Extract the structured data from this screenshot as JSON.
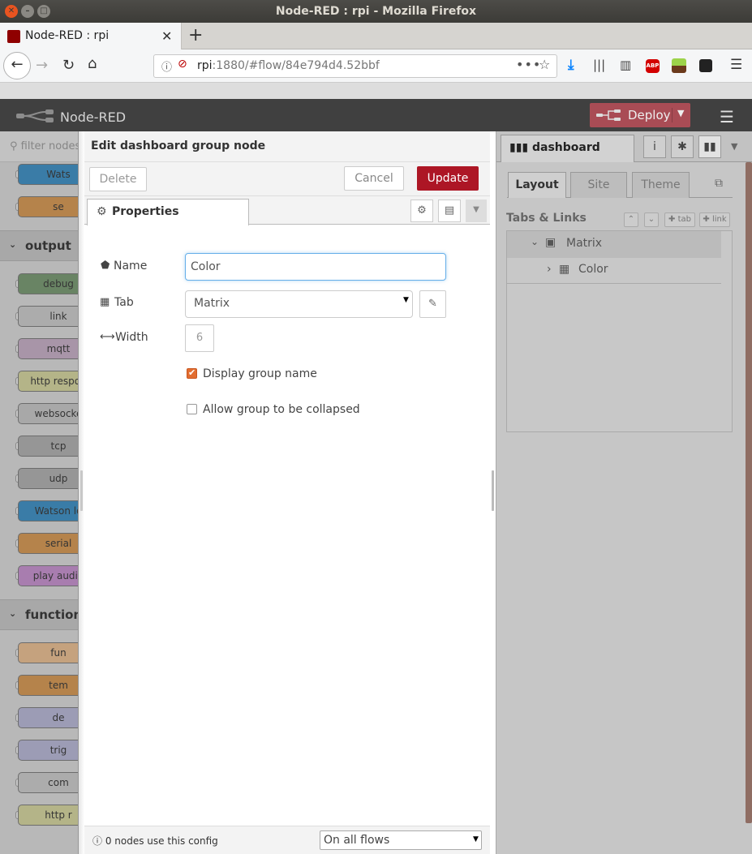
{
  "os": {
    "window_title": "Node-RED : rpi - Mozilla Firefox"
  },
  "browser": {
    "tab_title": "Node-RED : rpi",
    "url_host": "rpi",
    "url_rest": ":1880/#flow/84e794d4.52bbf",
    "abp_label": "ABP"
  },
  "header": {
    "title": "Node-RED",
    "deploy_label": "Deploy"
  },
  "palette": {
    "filter_placeholder": "filter nodes",
    "top_nodes": [
      {
        "label": "Wats",
        "color": "#4a9fd6"
      },
      {
        "label": "se",
        "color": "#e8a860"
      }
    ],
    "categories": [
      {
        "name": "output",
        "nodes": [
          {
            "label": "debug",
            "color": "#87a980"
          },
          {
            "label": "link",
            "color": "#dddddd"
          },
          {
            "label": "mqtt",
            "color": "#d8bfd8"
          },
          {
            "label": "http respon",
            "color": "#e7e7ae"
          },
          {
            "label": "websocke",
            "color": "#d8d8d8"
          },
          {
            "label": "tcp",
            "color": "#c0c0c0"
          },
          {
            "label": "udp",
            "color": "#c0c0c0"
          },
          {
            "label": "Watson lo",
            "color": "#4a9fd6"
          },
          {
            "label": "serial",
            "color": "#e8a860"
          },
          {
            "label": "play audio",
            "color": "#d8a0e0"
          }
        ]
      },
      {
        "name": "function",
        "nodes": [
          {
            "label": "fun",
            "color": "#fdd0a2"
          },
          {
            "label": "tem",
            "color": "#e8a860"
          },
          {
            "label": "de",
            "color": "#c8c8e8"
          },
          {
            "label": "trig",
            "color": "#c8c8e8"
          },
          {
            "label": "com",
            "color": "#dddddd"
          },
          {
            "label": "http r",
            "color": "#e7e7ae"
          }
        ]
      }
    ]
  },
  "tray": {
    "title": "Edit dashboard group node",
    "delete_label": "Delete",
    "cancel_label": "Cancel",
    "update_label": "Update",
    "properties_tab": "Properties",
    "fields": {
      "name_label": "Name",
      "name_value": "Color",
      "tab_label": "Tab",
      "tab_value": "Matrix",
      "width_label": "Width",
      "width_value": "6",
      "display_group_name_label": "Display group name",
      "display_group_name_checked": true,
      "allow_collapse_label": "Allow group to be collapsed",
      "allow_collapse_checked": false
    },
    "footer": {
      "usage_text": "0 nodes use this config",
      "scope_value": "On all flows"
    }
  },
  "sidebar": {
    "active_tab": "dashboard",
    "dashboard_tabs": [
      "Layout",
      "Site",
      "Theme"
    ],
    "section_label": "Tabs & Links",
    "add_tab_label": "tab",
    "add_link_label": "link",
    "tree": [
      {
        "label": "Matrix",
        "level": 0,
        "expanded": true
      },
      {
        "label": "Color",
        "level": 1,
        "expanded": false
      }
    ]
  },
  "colors": {
    "accent_red": "#ad1625",
    "deploy_red": "#8c101c",
    "checkbox_orange": "#e26d30"
  }
}
